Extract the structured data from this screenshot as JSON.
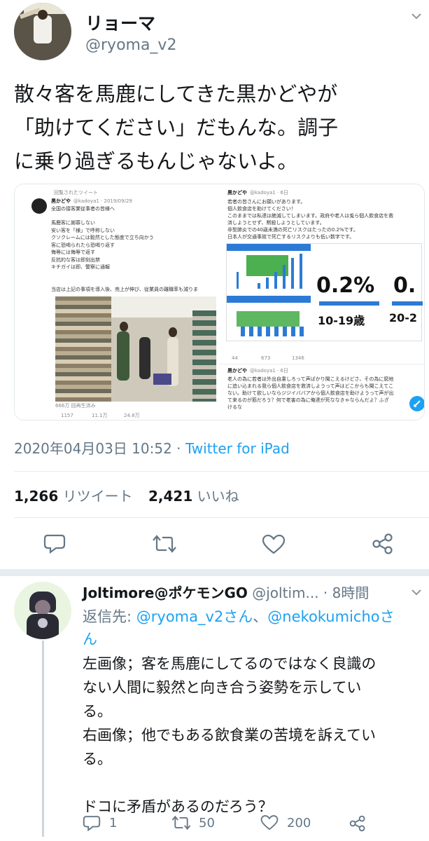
{
  "main_tweet": {
    "display_name": "リョーマ",
    "handle": "@ryoma_v2",
    "text_lines": [
      "散々客を馬鹿にしてきた黒かどやが",
      "「助けてください」だもんな。調子",
      "に乗り過ぎるもんじゃないよ。"
    ],
    "timestamp": "2020年04月03日 10:52",
    "separator": " · ",
    "client": "Twitter for iPad",
    "retweet_count": "1,266",
    "retweet_label": "リツイート",
    "like_count": "2,421",
    "like_label": "いいね",
    "embedded_left": {
      "rt_label": "回覧されたツイート",
      "name": "黒かどや",
      "meta": "@kadoya1 · 2019/09/29",
      "subtitle": "全国の接客業従事者の皆様へ",
      "lines": [
        "馬鹿客に謝罪しない",
        "安い客を「様」で呼称しない",
        "クソクレームには毅然とした態度で立ち向かう",
        "客に恐喝られたら恐喝り返す",
        "侮辱には侮辱で返す",
        "反抗的な客は即刻出禁",
        "キチガイは即、警察に通報"
      ],
      "footer_line": "当店は上記の事項を導入後、売上が伸び、従業員の離職率も減りま",
      "views": "666万 回再生済み",
      "stats": [
        "1157",
        "11.1万",
        "24.8万"
      ]
    },
    "embedded_right": {
      "name": "黒かどや",
      "handle": "@kadoya1 · 6日",
      "lines": [
        "若者の皆さんにお願いがあります。",
        "個人飲食店を助けてください！",
        "このままでは私達は絶滅してしまいます。政府や老人は兎ら個人飲食店を救",
        "済しようとせず、黙殺しようとしています。",
        "非型肺炎での40歳未満の死亡リスクはたったの0.2%です。",
        "日本人が交通事故で死亡するリスクよりも低い数字です。"
      ],
      "chart_big_values": [
        "0.2%",
        "0."
      ],
      "chart_big_labels": [
        "10-19歳",
        "20-2"
      ],
      "stats": [
        "44",
        "673",
        "1346"
      ],
      "second_name": "黒かどや",
      "second_handle": "@kadoya1 · 6日",
      "second_lines": [
        "老人の為に若者は外出自粛しろって声ばかり聞こえるけどさ、その為に窮地",
        "に追い込まれる我ら個人飲食店を救済しようって声はどこからも聞こえてこ",
        "ない。助けて欲しいならジジイババアから個人飲食店を助けようって声が出",
        "て来るのが筋だろう？何で老害の為に俺達が死ななきゃならんだよ？ふざ",
        "けるな"
      ]
    }
  },
  "reply": {
    "display_name": "Joltimore@ポケモンGO",
    "handle": "@joltim...",
    "time": "· 8時間",
    "reply_prefix": "返信先:",
    "reply_to_1": "@ryoma_v2さん",
    "reply_sep": "、",
    "reply_to_2": "@nekokumichoさ",
    "reply_to_2b": "ん",
    "body_lines": [
      "左画像；客を馬鹿にしてるのではなく良識の",
      "ない人間に毅然と向き合う姿勢を示してい",
      "る。",
      "右画像；他でもある飲食業の苦境を訴えてい",
      "る。",
      "",
      "ドコに矛盾があるのだろう？"
    ],
    "reply_count": "1",
    "retweet_count": "50",
    "like_count": "200"
  },
  "colors": {
    "accent": "#1da1f2",
    "muted": "#657786",
    "divider": "#e6ecf0",
    "chart_green": "#4caf50",
    "chart_blue": "#2b7bd6"
  },
  "icons": [
    "reply-icon",
    "retweet-icon",
    "like-icon",
    "share-icon",
    "chevron-down-icon",
    "compose-icon"
  ]
}
